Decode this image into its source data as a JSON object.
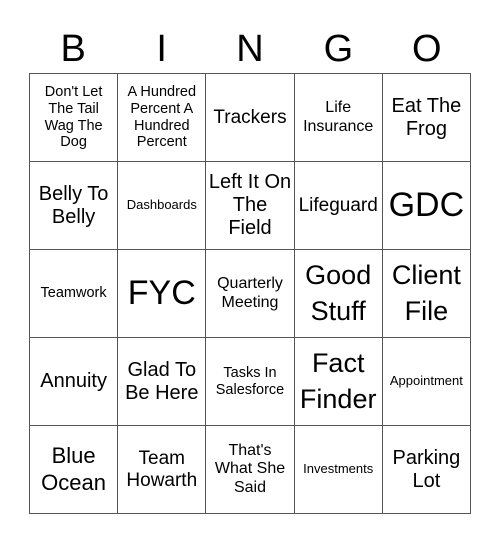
{
  "header": [
    "B",
    "I",
    "N",
    "G",
    "O"
  ],
  "cells": [
    "Don't Let The Tail Wag The Dog",
    "A Hundred Percent A Hundred Percent",
    "Trackers",
    "Life Insurance",
    "Eat The Frog",
    "Belly To Belly",
    "Dashboards",
    "Left It On The Field",
    "Lifeguard",
    "GDC",
    "Teamwork",
    "FYC",
    "Quarterly Meeting",
    "Good Stuff",
    "Client File",
    "Annuity",
    "Glad To Be Here",
    "Tasks In Salesforce",
    "Fact Finder",
    "Appointment",
    "Blue Ocean",
    "Team Howarth",
    "That's What She Said",
    "Investments",
    "Parking Lot"
  ]
}
